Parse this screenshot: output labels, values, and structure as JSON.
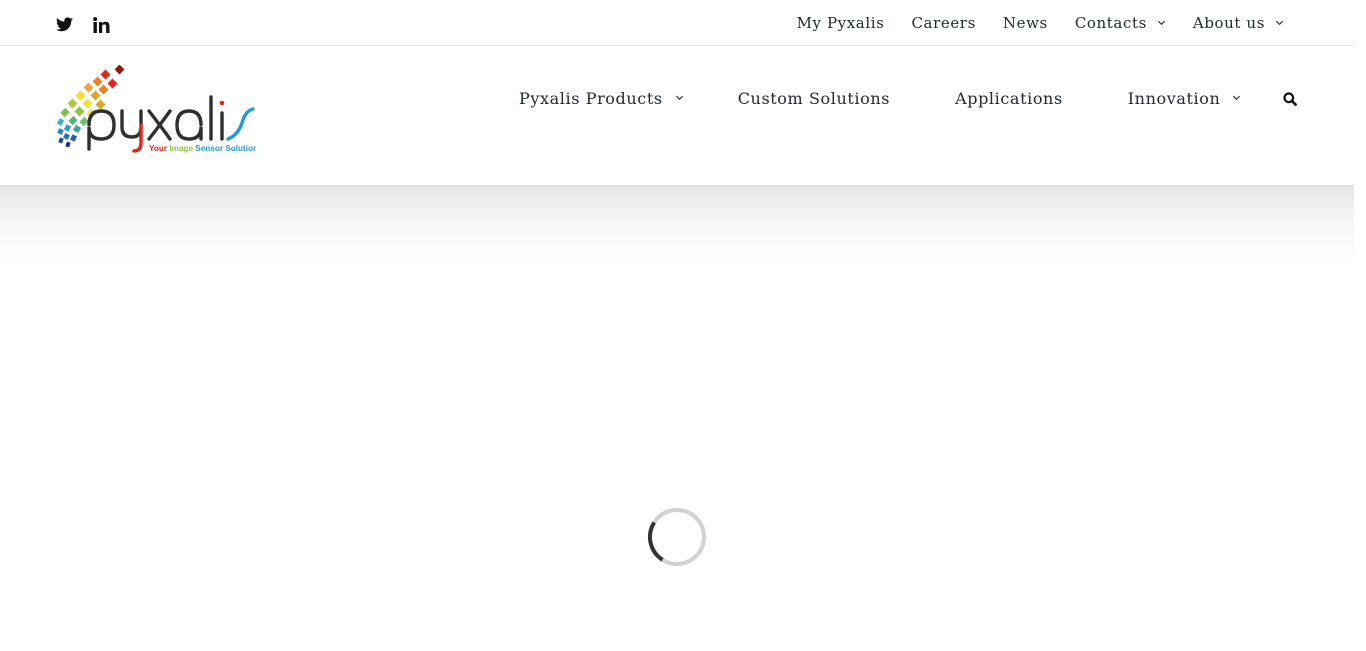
{
  "topbar": {
    "social": [
      {
        "icon": "twitter-icon",
        "label": "Twitter"
      },
      {
        "icon": "linkedin-icon",
        "label": "LinkedIn"
      }
    ],
    "links": [
      {
        "label": "My Pyxalis",
        "has_dropdown": false
      },
      {
        "label": "Careers",
        "has_dropdown": false
      },
      {
        "label": "News",
        "has_dropdown": false
      },
      {
        "label": "Contacts",
        "has_dropdown": true
      },
      {
        "label": "About us",
        "has_dropdown": true
      }
    ]
  },
  "header": {
    "logo": {
      "wordmark": "pyxalis",
      "tagline_parts": [
        "Your ",
        "Image ",
        "Sensor Solution"
      ],
      "colors": {
        "wordmark": "#2f2f2f",
        "accent_blue": "#1e9bd7",
        "tag_red": "#e02b20",
        "tag_green": "#8dc63f",
        "tag_blue": "#1e9bd7"
      }
    },
    "nav": [
      {
        "label": "Pyxalis Products",
        "has_dropdown": true
      },
      {
        "label": "Custom Solutions",
        "has_dropdown": false
      },
      {
        "label": "Applications",
        "has_dropdown": false
      },
      {
        "label": "Innovation",
        "has_dropdown": true
      }
    ],
    "search_icon": "search-icon"
  },
  "loading": {
    "icon": "loading-spinner-icon",
    "colors": {
      "track": "#d2d2d2",
      "arc": "#333333"
    }
  }
}
